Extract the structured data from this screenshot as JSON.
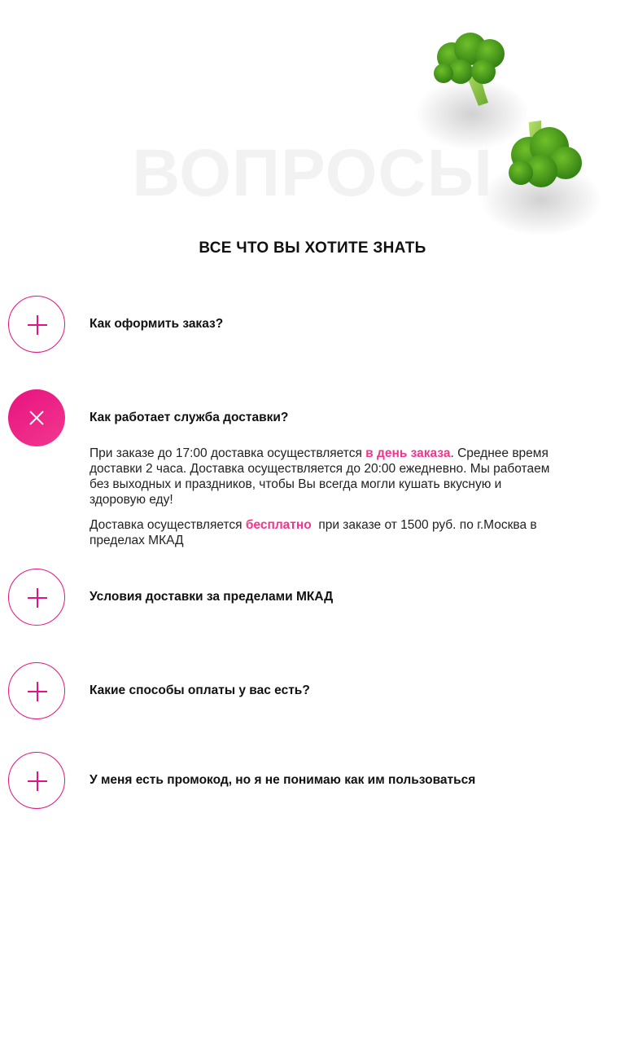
{
  "header": {
    "background_word": "ВОПРОСЫ",
    "subtitle": "ВСЕ ЧТО ВЫ ХОТИТЕ ЗНАТЬ"
  },
  "colors": {
    "accent": "#e6127f",
    "accent_light": "#f0378d",
    "text": "#111111",
    "background_word": "#f2f2f2"
  },
  "faq": [
    {
      "question": "Как оформить заказ?",
      "state": "collapsed",
      "icon": "plus-icon"
    },
    {
      "question": "Как работает служба доставки?",
      "state": "expanded",
      "icon": "close-icon",
      "answer": {
        "p1_before": "При заказе до 17:00 доставка осуществляется ",
        "p1_highlight": "в день заказа",
        "p1_after": ". Среднее время доставки 2 часа. Доставка осуществляется до 20:00 ежедневно. Мы работаем без выходных и праздников, чтобы Вы всегда могли кушать вкусную и здоровую еду!",
        "p2_before": "Доставка осуществляется ",
        "p2_highlight": "бесплатно",
        "p2_after": "  при заказе от 1500 руб. по г.Москва в пределах МКАД"
      }
    },
    {
      "question": "Условия доставки за пределами МКАД",
      "state": "collapsed",
      "icon": "plus-icon"
    },
    {
      "question": "Какие способы оплаты у вас есть?",
      "state": "collapsed",
      "icon": "plus-icon"
    },
    {
      "question": "У меня есть промокод, но я не понимаю как им пользоваться",
      "state": "collapsed",
      "icon": "plus-icon"
    }
  ]
}
